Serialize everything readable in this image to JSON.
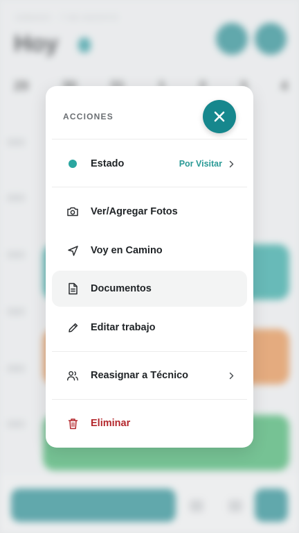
{
  "background": {
    "subtitle": "SÁBADO · 7 DE AGOSTO",
    "title": "Hoy",
    "days": [
      "29",
      "30",
      "31",
      "1",
      "2",
      "3",
      "4"
    ]
  },
  "modal": {
    "header": "ACCIONES",
    "close_icon": "close-icon",
    "status": {
      "label": "Estado",
      "value": "Por Visitar",
      "dot_color": "#2aa6a0"
    },
    "items": {
      "photos": "Ver/Agregar Fotos",
      "on_the_way": "Voy en Camino",
      "documents": "Documentos",
      "edit": "Editar trabajo",
      "reassign": "Reasignar a Técnico",
      "delete": "Eliminar"
    },
    "colors": {
      "accent": "#16878d",
      "danger": "#b3262b",
      "status": "#2a9a96"
    }
  }
}
